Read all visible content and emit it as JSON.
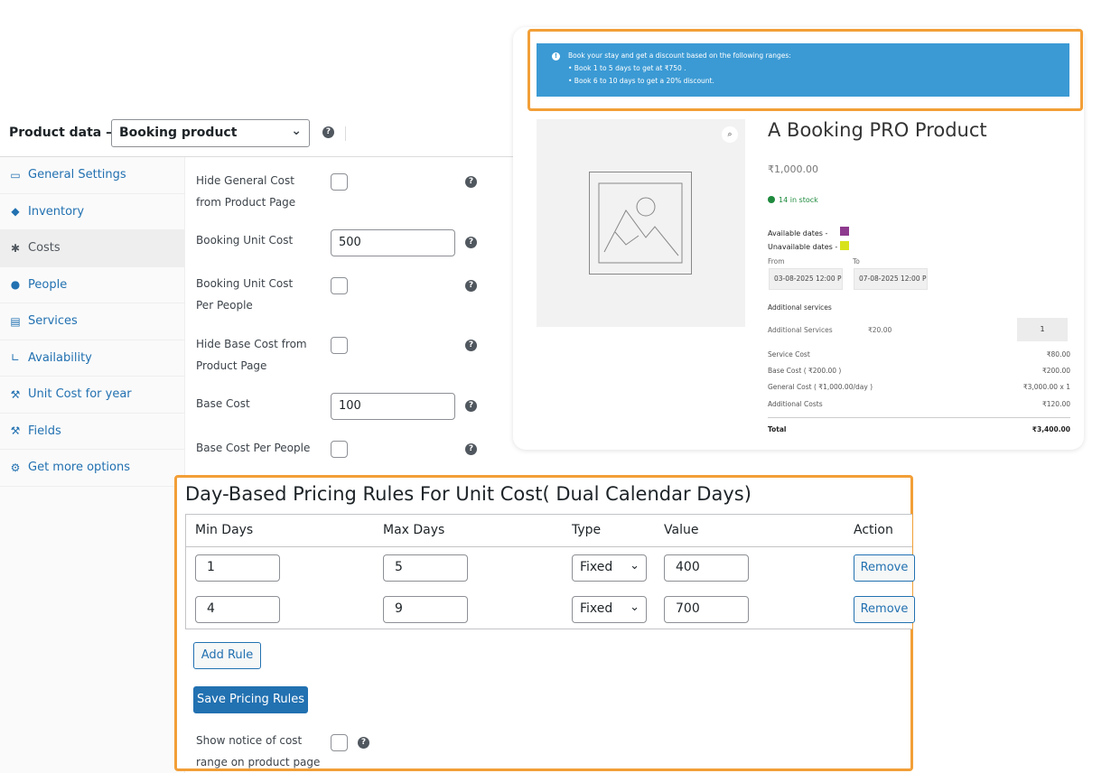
{
  "header": {
    "title": "Product data —",
    "product_type": "Booking product"
  },
  "tabs": [
    {
      "label": "General Settings",
      "icon": "window-icon"
    },
    {
      "label": "Inventory",
      "icon": "tag-icon"
    },
    {
      "label": "Costs",
      "icon": "gear-icon"
    },
    {
      "label": "People",
      "icon": "person-icon"
    },
    {
      "label": "Services",
      "icon": "id-card-icon"
    },
    {
      "label": "Availability",
      "icon": "chart-icon"
    },
    {
      "label": "Unit Cost for year",
      "icon": "wrench-icon"
    },
    {
      "label": "Fields",
      "icon": "wrench-icon"
    },
    {
      "label": "Get more options",
      "icon": "admin-tools-icon"
    }
  ],
  "costs": {
    "hide_general_cost_label": "Hide General Cost from Product Page",
    "booking_unit_cost_label": "Booking Unit Cost",
    "booking_unit_cost_value": "500",
    "booking_unit_cost_per_people_label": "Booking Unit Cost Per People",
    "hide_base_cost_label": "Hide Base Cost from Product Page",
    "base_cost_label": "Base Cost",
    "base_cost_value": "100",
    "base_cost_per_people_label": "Base Cost Per People"
  },
  "preview": {
    "notice_line1": "Book your stay and get a discount based on the following ranges:",
    "notice_line2": "• Book 1 to 5 days to get at ₹750 .",
    "notice_line3": "• Book 6 to 10 days to get a 20% discount.",
    "product_title": "A Booking PRO Product",
    "price": "₹1,000.00",
    "stock": "14 in stock",
    "available_dates_label": "Available dates -",
    "unavailable_dates_label": "Unavailable dates -",
    "available_color": "#8e3a8e",
    "unavailable_color": "#d8e21c",
    "from_label": "From",
    "to_label": "To",
    "from_value": "03-08-2025 12:00 PM",
    "to_value": "07-08-2025 12:00 PM",
    "additional_services_heading": "Additional services",
    "additional_services_label": "Additional Services",
    "additional_services_price": "₹20.00",
    "additional_services_qty": "1",
    "costs": [
      {
        "label": "Service Cost",
        "value": "₹80.00"
      },
      {
        "label": "Base Cost ( ₹200.00 )",
        "value": "₹200.00"
      },
      {
        "label": "General Cost ( ₹1,000.00/day )",
        "value": "₹3,000.00 x 1"
      },
      {
        "label": "Additional Costs",
        "value": "₹120.00"
      }
    ],
    "total_label": "Total",
    "total_value": "₹3,400.00"
  },
  "rules": {
    "title": "Day-Based Pricing Rules For Unit Cost( Dual Calendar Days)",
    "headers": [
      "Min Days",
      "Max Days",
      "Type",
      "Value",
      "Action"
    ],
    "rows": [
      {
        "min": "1",
        "max": "5",
        "type": "Fixed",
        "value": "400",
        "action": "Remove"
      },
      {
        "min": "4",
        "max": "9",
        "type": "Fixed",
        "value": "700",
        "action": "Remove"
      }
    ],
    "add_rule": "Add Rule",
    "save": "Save Pricing Rules",
    "show_notice_label": "Show notice of cost range on product page"
  },
  "colors": {
    "accent": "#2271b1",
    "highlight_border": "#f29f38",
    "notice_bg": "#3b9ad4"
  }
}
